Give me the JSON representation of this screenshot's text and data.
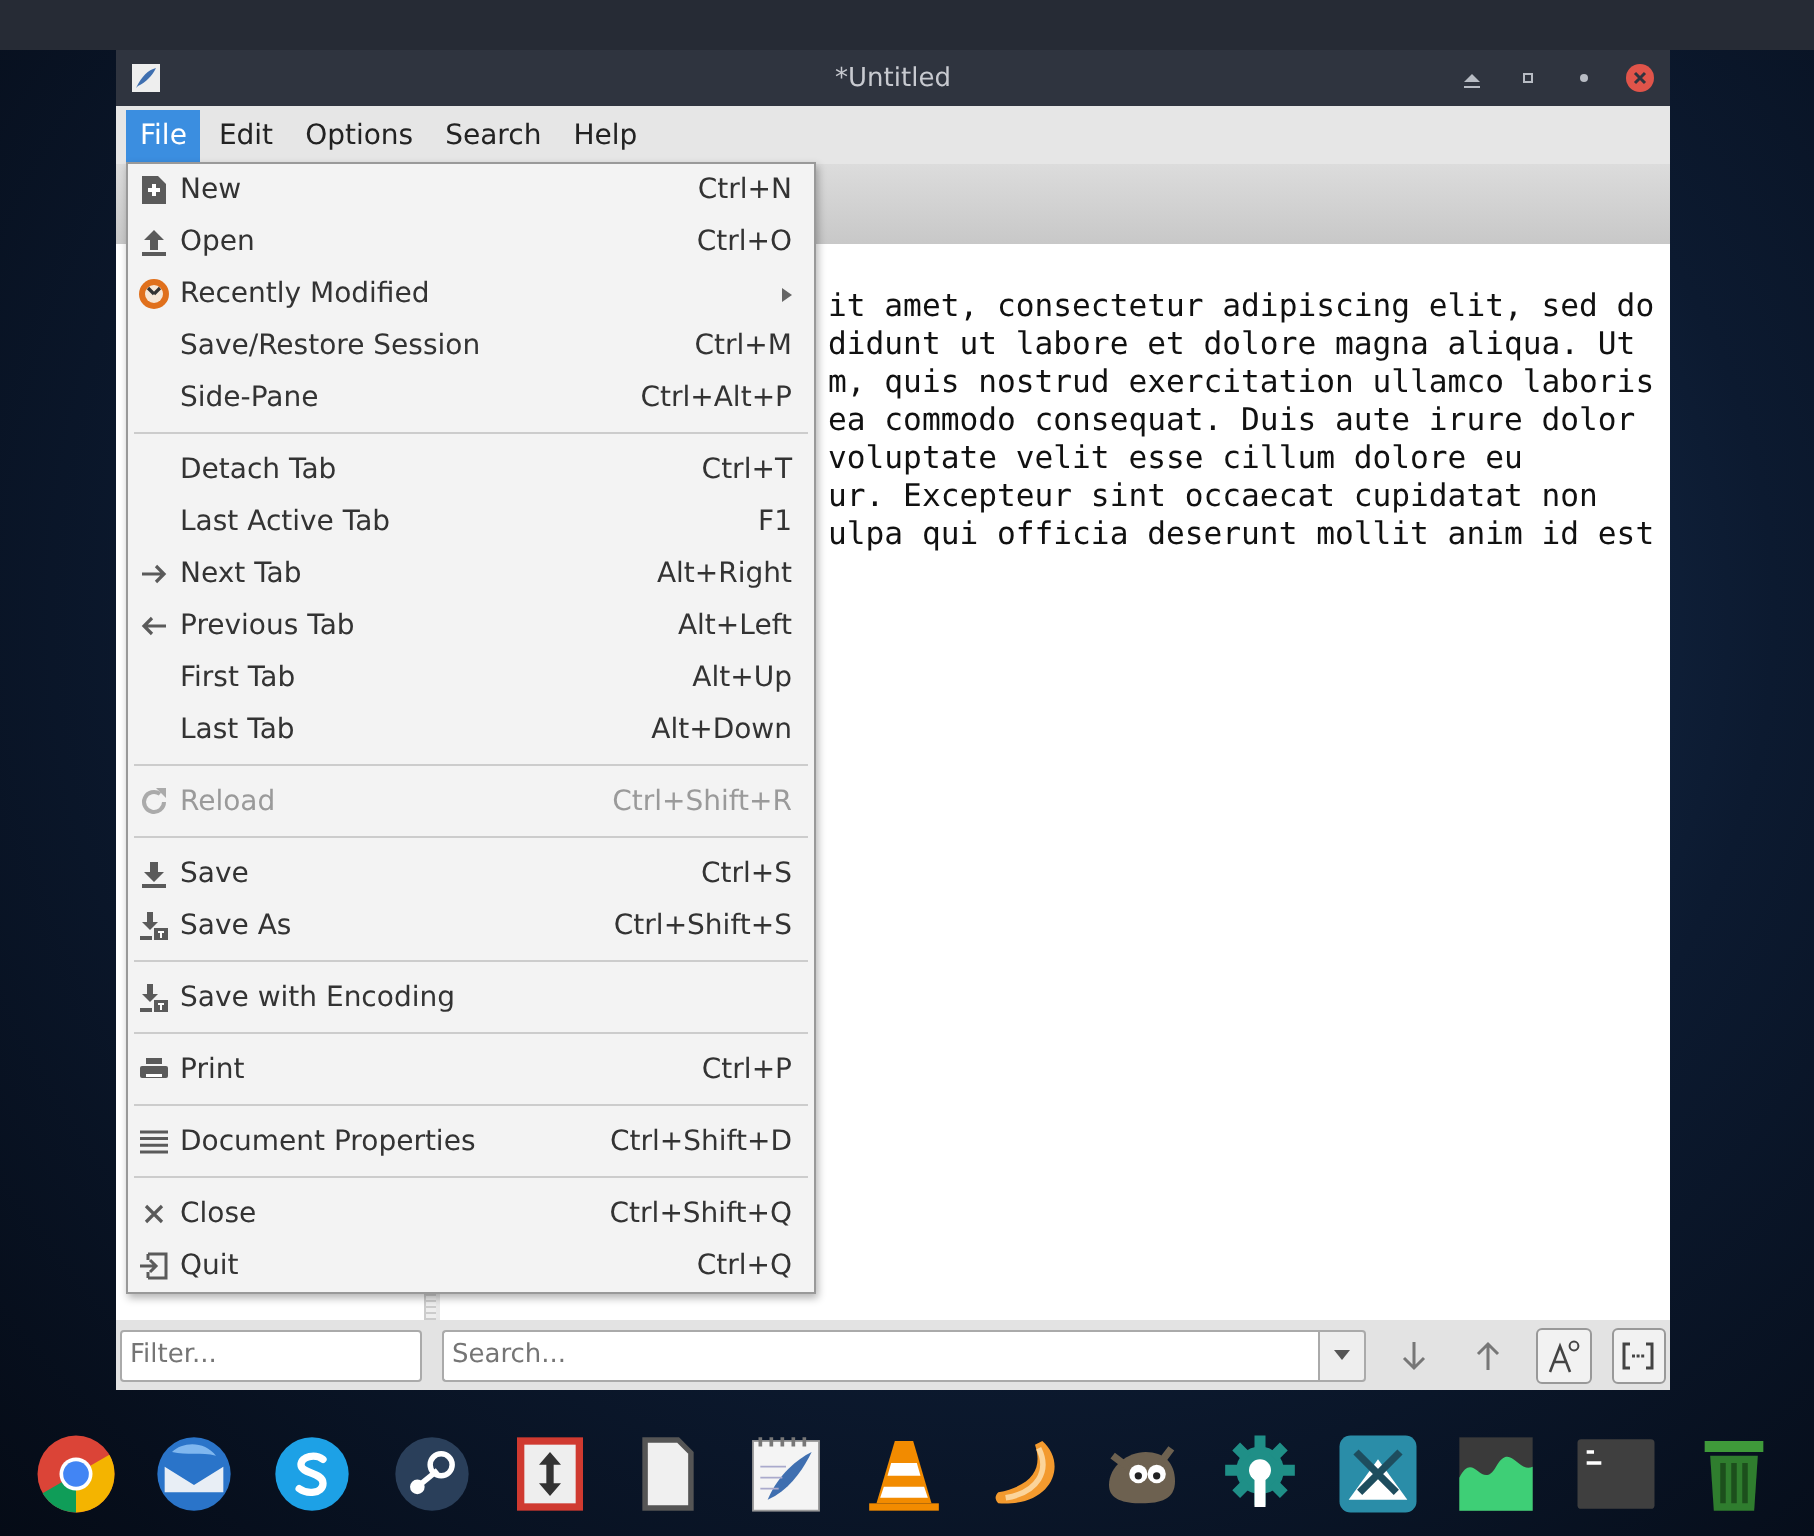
{
  "window": {
    "title": "*Untitled"
  },
  "menubar": [
    {
      "label": "File",
      "selected": true
    },
    {
      "label": "Edit",
      "selected": false
    },
    {
      "label": "Options",
      "selected": false
    },
    {
      "label": "Search",
      "selected": false
    },
    {
      "label": "Help",
      "selected": false
    }
  ],
  "file_menu": {
    "groups": [
      [
        {
          "label": "New",
          "shortcut": "Ctrl+N",
          "disabled": false,
          "submenu": false
        },
        {
          "label": "Open",
          "shortcut": "Ctrl+O",
          "disabled": false,
          "submenu": false
        },
        {
          "label": "Recently Modified",
          "disabled": false,
          "submenu": true
        },
        {
          "label": "Save/Restore Session",
          "shortcut": "Ctrl+M",
          "disabled": false,
          "submenu": false
        },
        {
          "label": "Side-Pane",
          "shortcut": "Ctrl+Alt+P",
          "disabled": false,
          "submenu": false
        }
      ],
      [
        {
          "label": "Detach Tab",
          "shortcut": "Ctrl+T",
          "disabled": false,
          "submenu": false
        },
        {
          "label": "Last Active Tab",
          "shortcut": "F1",
          "disabled": false,
          "submenu": false
        },
        {
          "label": "Next Tab",
          "shortcut": "Alt+Right",
          "disabled": false,
          "submenu": false
        },
        {
          "label": "Previous Tab",
          "shortcut": "Alt+Left",
          "disabled": false,
          "submenu": false
        },
        {
          "label": "First Tab",
          "shortcut": "Alt+Up",
          "disabled": false,
          "submenu": false
        },
        {
          "label": "Last Tab",
          "shortcut": "Alt+Down",
          "disabled": false,
          "submenu": false
        }
      ],
      [
        {
          "label": "Reload",
          "shortcut": "Ctrl+Shift+R",
          "disabled": true,
          "submenu": false
        }
      ],
      [
        {
          "label": "Save",
          "shortcut": "Ctrl+S",
          "disabled": false,
          "submenu": false
        },
        {
          "label": "Save As",
          "shortcut": "Ctrl+Shift+S",
          "disabled": false,
          "submenu": false
        }
      ],
      [
        {
          "label": "Save with Encoding",
          "disabled": false,
          "submenu": false
        }
      ],
      [
        {
          "label": "Print",
          "shortcut": "Ctrl+P",
          "disabled": false,
          "submenu": false
        }
      ],
      [
        {
          "label": "Document Properties",
          "shortcut": "Ctrl+Shift+D",
          "disabled": false,
          "submenu": false
        }
      ],
      [
        {
          "label": "Close",
          "shortcut": "Ctrl+Shift+Q",
          "disabled": false,
          "submenu": false
        },
        {
          "label": "Quit",
          "shortcut": "Ctrl+Q",
          "disabled": false,
          "submenu": false
        }
      ]
    ]
  },
  "editor": {
    "lines": [
      "it amet, consectetur adipiscing elit, sed do",
      "didunt ut labore et dolore magna aliqua. Ut",
      "m, quis nostrud exercitation ullamco laboris",
      "ea commodo consequat. Duis aute irure dolor",
      "voluptate velit esse cillum dolore eu",
      "ur. Excepteur sint occaecat cupidatat non",
      "ulpa qui officia deserunt mollit anim id est"
    ]
  },
  "bottom_bar": {
    "filter": {
      "placeholder": "Filter..."
    },
    "search": {
      "placeholder": "Search..."
    }
  }
}
